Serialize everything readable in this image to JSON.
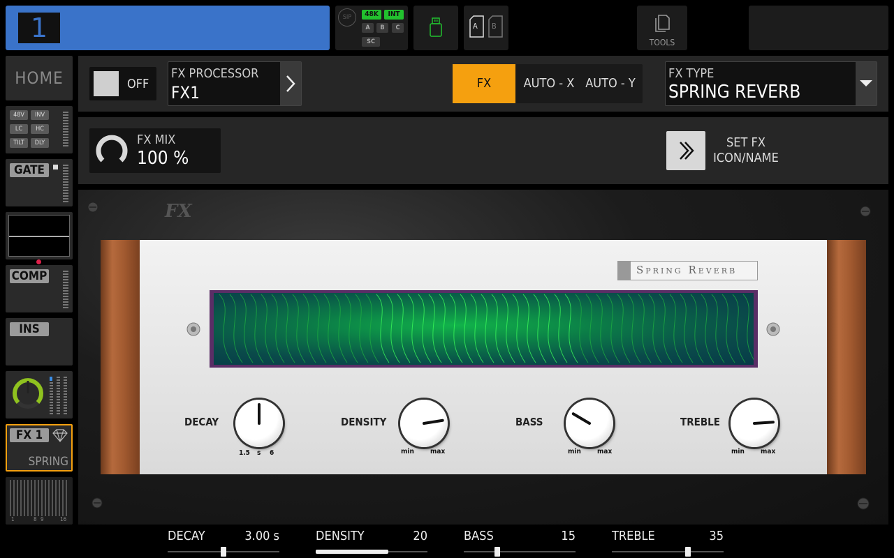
{
  "topbar": {
    "channel_number": "1",
    "sip_label": "SIP",
    "rate_label": "48K",
    "clock_label": "INT",
    "bus_a": "A",
    "bus_b": "B",
    "bus_c": "C",
    "sc_label": "SC",
    "ab_a": "A",
    "ab_b": "B",
    "tools_label": "TOOLS"
  },
  "sidebar": {
    "home": "HOME",
    "preamp_flags": [
      "48V",
      "INV",
      "LC",
      "HC",
      "TILT",
      "DLY"
    ],
    "gate": "GATE",
    "comp": "COMP",
    "ins": "INS",
    "fx_slot": "FX 1",
    "fx_slot_type": "SPRING",
    "meter_scale_left": "1",
    "meter_scale_mid1": "8",
    "meter_scale_mid2": "9",
    "meter_scale_right": "16"
  },
  "fx_header": {
    "power_label": "OFF",
    "processor_caption": "FX PROCESSOR",
    "processor_value": "FX1",
    "mode_fx": "FX",
    "mode_auto_x": "AUTO - X",
    "mode_auto_y": "AUTO - Y",
    "type_caption": "FX TYPE",
    "type_value": "SPRING REVERB",
    "mix_caption": "FX MIX",
    "mix_value": "100 %",
    "set_icon_line1": "SET FX",
    "set_icon_line2": "ICON/NAME"
  },
  "plugin": {
    "logo": "FX",
    "badge": "Spring Reverb",
    "knobs": [
      {
        "label": "DECAY",
        "min": "1.5",
        "unit": "s",
        "max": "6",
        "level": 0.5
      },
      {
        "label": "DENSITY",
        "min": "min",
        "unit": "",
        "max": "max",
        "level": 0.8
      },
      {
        "label": "BASS",
        "min": "min",
        "unit": "",
        "max": "max",
        "level": 0.28
      },
      {
        "label": "TREBLE",
        "min": "min",
        "unit": "",
        "max": "max",
        "level": 0.82
      }
    ]
  },
  "params": [
    {
      "name": "DECAY",
      "value": "3.00 s",
      "level": 0.5,
      "style": "handle"
    },
    {
      "name": "DENSITY",
      "value": "20",
      "level": 0.65,
      "style": "fill"
    },
    {
      "name": "BASS",
      "value": "15",
      "level": 0.3,
      "style": "handle"
    },
    {
      "name": "TREBLE",
      "value": "35",
      "level": 0.68,
      "style": "handle"
    }
  ],
  "colors": {
    "channel_blue": "#3a73c9",
    "fx_orange": "#f5a00f",
    "active_green": "#22c12e",
    "slot_outline": "#f5a00f"
  }
}
